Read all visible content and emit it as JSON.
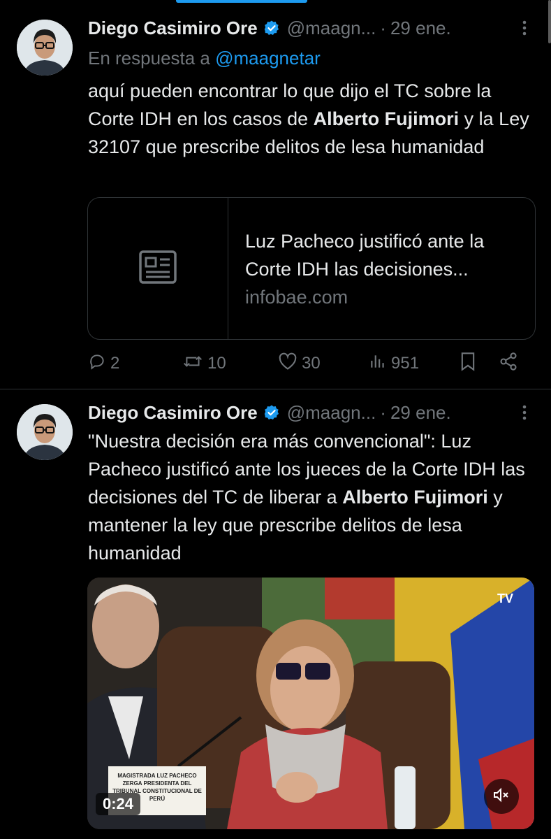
{
  "tweets": [
    {
      "author_name": "Diego Casimiro Ore",
      "handle": "@maagn...",
      "dot": "·",
      "date": "29 ene.",
      "replying_prefix": "En respuesta a",
      "replying_handle": "@maagnetar",
      "text_parts": [
        "aquí pueden encontrar lo que dijo el TC sobre la Corte IDH en los casos de ",
        "Alberto Fujimori",
        " y la Ley 32107 que prescribe delitos de lesa humanidad"
      ],
      "card": {
        "title": "Luz Pacheco justificó ante la Corte IDH las decisiones...",
        "domain": "infobae.com",
        "icon": "news-article-icon"
      },
      "stats": {
        "replies": "2",
        "reposts": "10",
        "likes": "30",
        "views": "951"
      }
    },
    {
      "author_name": "Diego Casimiro Ore",
      "handle": "@maagn...",
      "dot": "·",
      "date": "29 ene.",
      "text_parts": [
        "\"Nuestra decisión era más convencional\": Luz Pacheco justificó ante los jueces de la Corte IDH las decisiones del TC de liberar a ",
        "Alberto Fujimori",
        " y mantener la ley que prescribe delitos de lesa humanidad"
      ],
      "media": {
        "timestamp": "0:24",
        "tv_logo": "TV",
        "nameplate": "MAGISTRADA LUZ PACHECO ZERGA PRESIDENTA DEL TRIBUNAL CONSTITUCIONAL DE PERÚ"
      }
    }
  ],
  "colors": {
    "background": "#000000",
    "text": "#e7e9ea",
    "muted": "#71767b",
    "accent": "#1d9bf0",
    "border": "#2f3336"
  }
}
